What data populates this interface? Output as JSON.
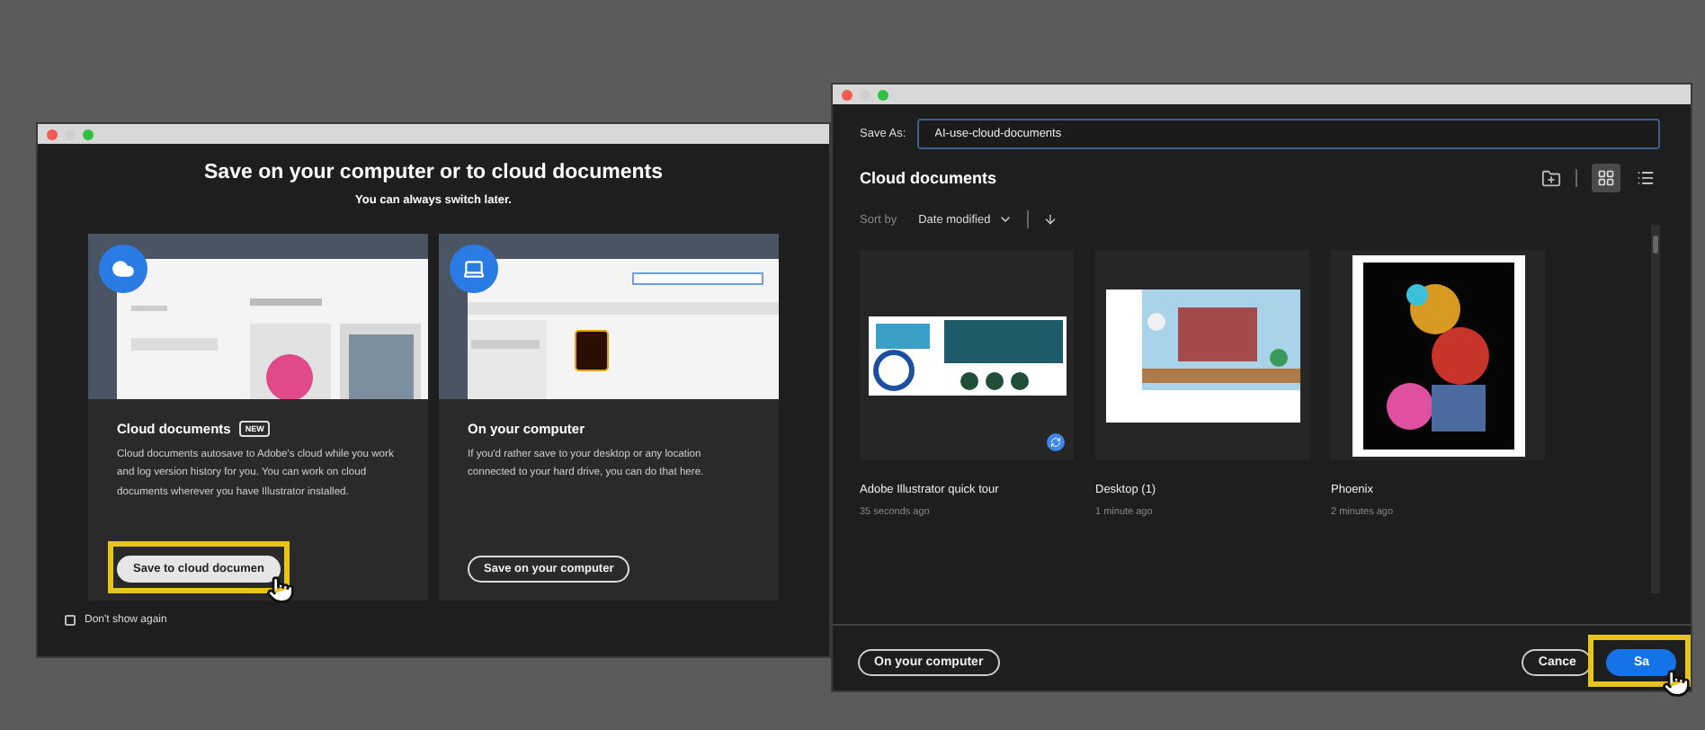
{
  "welcome_dialog": {
    "title": "Save on your computer or to cloud documents",
    "subtitle": "You can always switch later.",
    "options": [
      {
        "kind": "cloud",
        "title": "Cloud documents",
        "badge": "NEW",
        "description": "Cloud documents autosave to Adobe's cloud while you work and log version history for you. You can work on cloud documents wherever you have Illustrator installed.",
        "button": "Save to cloud documen",
        "highlighted": true
      },
      {
        "kind": "computer",
        "title": "On your computer",
        "description": "If you'd rather save to your desktop or any location connected to your hard drive, you can do that here.",
        "button": "Save on your computer",
        "highlighted": false
      }
    ],
    "dont_show_again": {
      "label": "Don't show again",
      "checked": false
    }
  },
  "save_dialog": {
    "save_as_label": "Save As:",
    "filename": "AI-use-cloud-documents",
    "location": "Cloud documents",
    "views": [
      {
        "kind": "grid",
        "selected": true
      },
      {
        "kind": "list",
        "selected": false
      }
    ],
    "sort": {
      "label": "Sort by",
      "value": "Date modified"
    },
    "files": [
      {
        "kind": "moto",
        "name": "Adobe Illustrator quick tour",
        "modified": "35 seconds ago",
        "synced": true
      },
      {
        "kind": "desk",
        "name": "Desktop (1)",
        "modified": "1 minute ago",
        "synced": false
      },
      {
        "kind": "phoenix",
        "name": "Phoenix",
        "modified": "2 minutes ago",
        "synced": false
      }
    ],
    "buttons": [
      {
        "kind": "outline",
        "label": "On your computer",
        "highlighted": false
      },
      {
        "kind": "outline",
        "label": "Cance",
        "highlighted": false
      },
      {
        "kind": "primary",
        "label": "Sa",
        "highlighted": true
      }
    ]
  }
}
